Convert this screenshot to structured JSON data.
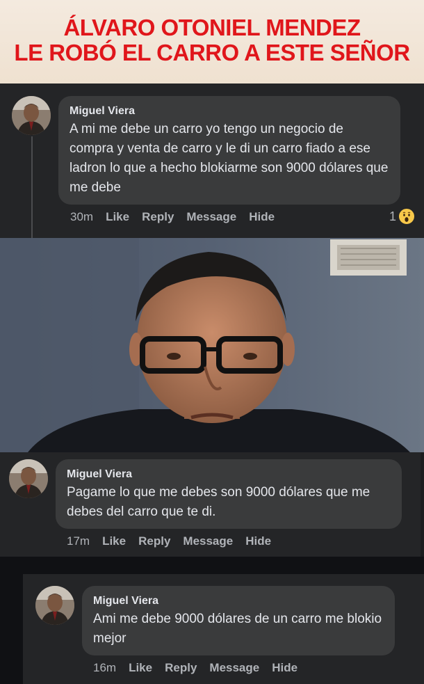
{
  "headline": {
    "line1": "ÁLVARO OTONIEL MENDEZ",
    "line2": "LE ROBÓ EL CARRO A ESTE SEÑOR",
    "color": "#e0161b"
  },
  "comments": [
    {
      "author": "Miguel Viera",
      "text": "A mi me debe un carro yo tengo un negocio de compra y venta de carro y le di un carro fiado a ese ladron lo que a hecho blokiarme son 9000 dólares que me debe",
      "time": "30m",
      "actions": [
        "Like",
        "Reply",
        "Message",
        "Hide"
      ],
      "reaction_count": "1",
      "reaction_icon": "wow-emoji-icon"
    },
    {
      "author": "Miguel Viera",
      "text": "Pagame lo que me debes son 9000 dólares que me debes del carro que te di.",
      "time": "17m",
      "actions": [
        "Like",
        "Reply",
        "Message",
        "Hide"
      ]
    },
    {
      "author": "Miguel Viera",
      "text": "Ami me debe 9000 dólares de un carro me blokio mejor",
      "time": "16m",
      "actions": [
        "Like",
        "Reply",
        "Message",
        "Hide"
      ]
    }
  ]
}
